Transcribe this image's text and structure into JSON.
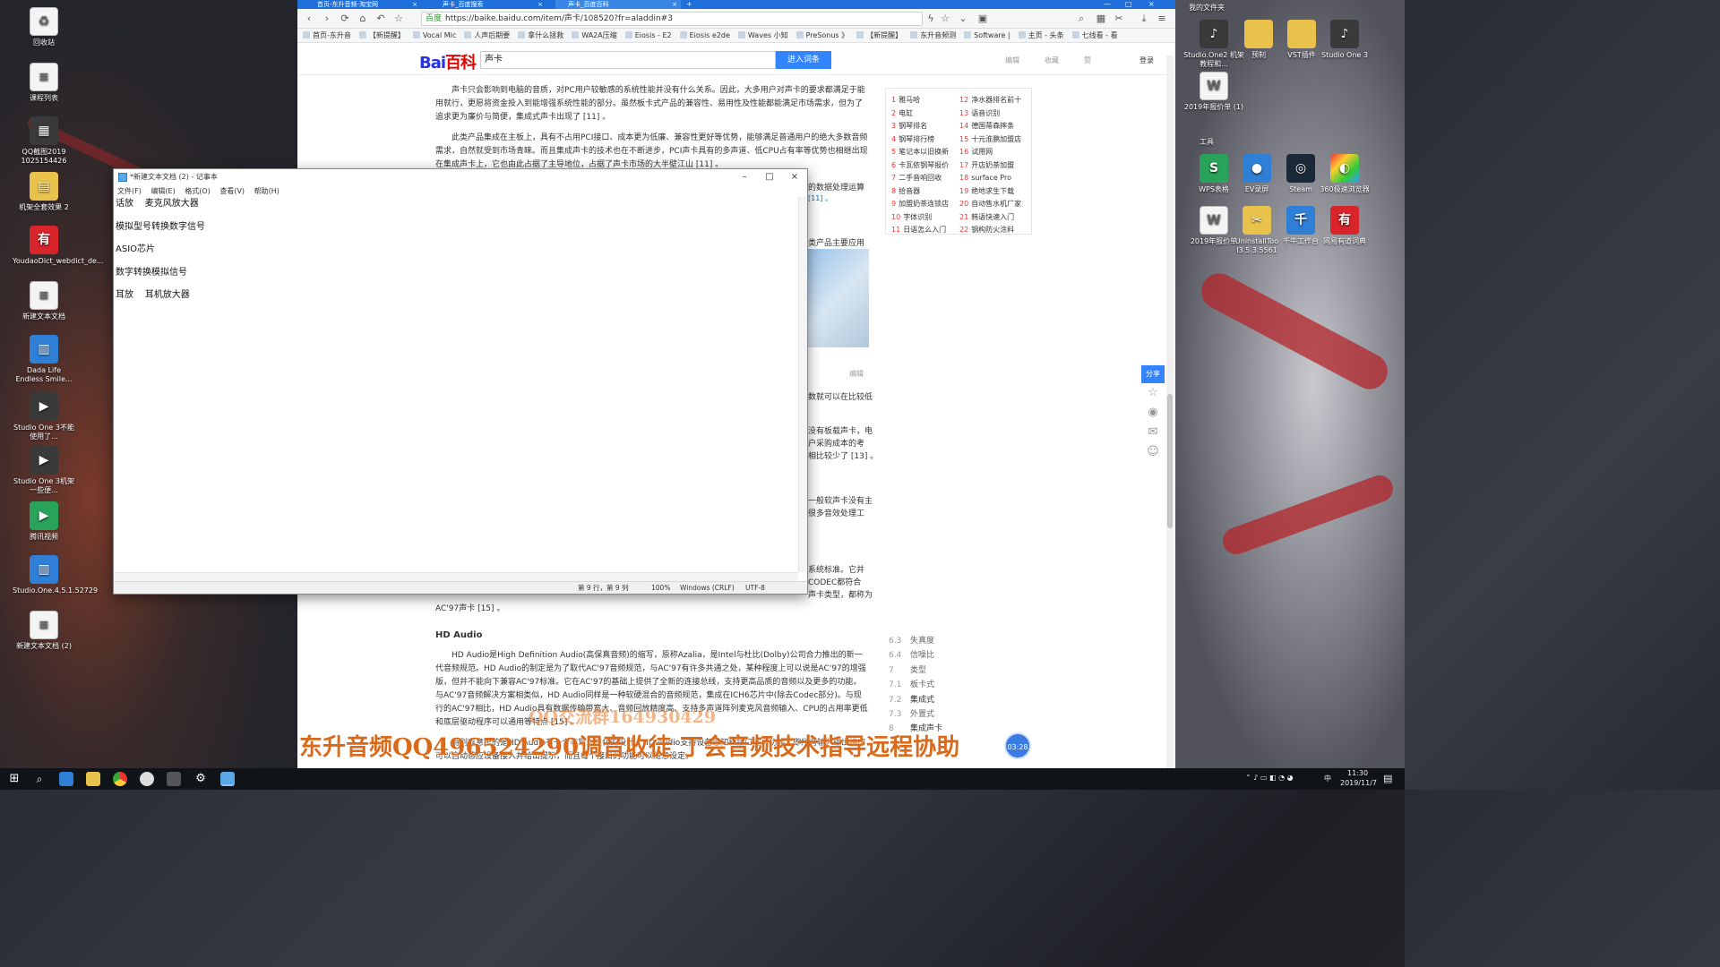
{
  "desktop_left": [
    {
      "label": "回收站",
      "icon": "recycle-bin-icon"
    },
    {
      "label": "课程列表",
      "icon": "text-file-icon"
    },
    {
      "label": "QQ截图2019 1025154426",
      "icon": "image-file-icon"
    },
    {
      "label": "机架全套效果 2",
      "icon": "archive-icon"
    },
    {
      "label": "YoudaoDict_webdict_de...",
      "icon": "youdao-icon"
    },
    {
      "label": "新建文本文档",
      "icon": "text-file-icon"
    },
    {
      "label": "Dada Life Endless Smile...",
      "icon": "zip-icon"
    },
    {
      "label": "Studio One 3不能使用了...",
      "icon": "video-file-icon"
    },
    {
      "label": "Studio One 3机架一些便...",
      "icon": "video-file-icon"
    },
    {
      "label": "腾讯视频",
      "icon": "tencent-video-icon"
    },
    {
      "label": "Studio.One.4.5.1.52729",
      "icon": "zip-icon"
    },
    {
      "label": "新建文本文档 (2)",
      "icon": "text-file-icon"
    }
  ],
  "desktop_right": [
    {
      "label": "我的文件夹",
      "icon": "folder-icon"
    },
    {
      "label": "Studio.One2 机架教程和...",
      "icon": "folder-icon"
    },
    {
      "label": "预制",
      "icon": "folder-icon"
    },
    {
      "label": "VST插件",
      "icon": "folder-icon"
    },
    {
      "label": "Studio One 3",
      "icon": "studio-one-icon"
    },
    {
      "label": "2019年报价单 (1)",
      "icon": "doc-file-icon"
    },
    {
      "label": "工具",
      "icon": "folder-icon"
    },
    {
      "label": "WPS表格",
      "icon": "wps-icon"
    },
    {
      "label": "EV录屏",
      "icon": "ev-recorder-icon"
    },
    {
      "label": "Steam",
      "icon": "steam-icon"
    },
    {
      "label": "360极速浏览器",
      "icon": "browser-360-icon"
    },
    {
      "label": "2019年报价单",
      "icon": "doc-file-icon"
    },
    {
      "label": "UninstallToo l3.5.3.5561",
      "icon": "uninstall-icon"
    },
    {
      "label": "千牛工作台",
      "icon": "qianniu-icon"
    },
    {
      "label": "网易有道词典",
      "icon": "youdao-icon"
    }
  ],
  "browser": {
    "tabs": [
      "首页-东升音频-淘宝网",
      "声卡_百度搜索",
      "声卡_百度百科"
    ],
    "url": "https://baike.baidu.com/item/声卡/108520?fr=aladdin#3",
    "url_badge": "百度",
    "bookmarks": [
      "首页-东升音",
      "【新提醒】",
      "Vocal Mic",
      "人声后期要",
      "拿什么拯救",
      "WA2A压缩",
      "Eiosis - E2",
      "Eiosis e2de",
      "Waves 小知",
      "PreSonus 》",
      "【新提醒】",
      "东升音频测",
      "Software |",
      "主页 - 头条",
      "七线看 - 看"
    ],
    "logo_a": "Bai",
    "logo_b": "百科",
    "search_value": "声卡",
    "enter_button": "进入词条",
    "header_links": [
      "编辑",
      "收藏",
      "赞",
      "登录"
    ],
    "paragraphs": [
      "声卡只会影响到电脑的音质，对PC用户较敏感的系统性能并没有什么关系。因此，大多用户对声卡的要求都满足于能用就行，更愿将资金投入到能增强系统性能的部分。虽然板卡式产品的兼容性、易用性及性能都能满足市场需求，但为了追求更为廉价与简便，集成式声卡出现了 [11] 。",
      "此类产品集成在主板上，具有不占用PCI接口、成本更为低廉、兼容性更好等优势，能够满足普通用户的绝大多数音频需求，自然就受到市场青睐。而且集成声卡的技术也在不断进步，PCI声卡具有的多声道、低CPU占有率等优势也相继出现在集成声卡上，它也由此占据了主导地位，占据了声卡市场的大半壁江山 [11] 。"
    ],
    "fragments": [
      "的数据处理运算",
      "[11] 。",
      "类产品主要应用",
      "数就可以在比较低",
      "没有板载声卡，电",
      "户采购成本的考",
      "相比较少了 [13] 。",
      "一般软声卡没有主",
      "很多音效处理工",
      "系统标准。它并",
      "CODEC都符合",
      "声卡类型，都称为",
      "AC'97声卡 [15] 。"
    ],
    "section_title": "HD Audio",
    "hd_paragraph": "HD Audio是High Definition Audio(高保真音频)的缩写，原称Azalia，是Intel与杜比(Dolby)公司合力推出的新一代音频规范。HD Audio的制定是为了取代AC'97音频规范，与AC'97有许多共通之处，某种程度上可以说是AC'97的增强版，但并不能向下兼容AC'97标准。它在AC'97的基础上提供了全新的连接总线，支持更高品质的音频以及更多的功能。与AC'97音频解决方案相类似，HD Audio同样是一种软硬混合的音频规范，集成在ICH6芯片中(除去Codec部分)。与现行的AC'97相比，HD Audio具有数据传输带宽大、音频回放精度高、支持多声道阵列麦克风音频输入、CPU的占用率更低和底层驱动程序可以通用等特点 [15] 。",
    "hd_paragraph2": "特别有意思的是HD Audio有一个非常人性化的设计，HD Audio支持设备感知和接口定义功能，即所有输入输出接口可以自动感应设备接入并给出提示，而且每个接口的功能可以随意设定。",
    "edit_label": "编辑",
    "ranking": [
      "雅马哈",
      "电缸",
      "钢琴排名",
      "钢琴排行榜",
      "笔记本以旧换新",
      "卡瓦依钢琴报价",
      "二手音响回收",
      "拾音器",
      "加盟奶茶连锁店",
      "字体识别",
      "日语怎么入门",
      "净水器排名前十",
      "语音识别",
      "德国蒂森摔条",
      "十元淮鹏加盟店",
      "试用网",
      "开店奶茶加盟",
      "surface Pro",
      "绝地求生下载",
      "自动售水机厂家",
      "韩语快速入门",
      "钢构防火涂料"
    ],
    "catalog": [
      {
        "num": "6.3",
        "label": "失真度"
      },
      {
        "num": "6.4",
        "label": "信噪比"
      },
      {
        "num": "7",
        "label": "类型"
      },
      {
        "num": "7.1",
        "label": "板卡式"
      },
      {
        "num": "7.2",
        "label": "集成式"
      },
      {
        "num": "7.3",
        "label": "外置式"
      },
      {
        "num": "8",
        "label": "集成声卡"
      }
    ],
    "share_label": "分享",
    "timer": "03:28"
  },
  "notepad": {
    "title": "*新建文本文档 (2) - 记事本",
    "menu": [
      "文件(F)",
      "编辑(E)",
      "格式(O)",
      "查看(V)",
      "帮助(H)"
    ],
    "content": "话放    麦克风放大器\n\n模拟型号转换数字信号\n\nASIO芯片\n\n数字转换模拟信号\n\n耳放    耳机放大器",
    "status_pos": "第 9 行，第 9 列",
    "status_zoom": "100%",
    "status_eol": "Windows (CRLF)",
    "status_enc": "UTF-8"
  },
  "watermark_qq": "QQ交流群164930429",
  "watermark_main": "东升音频QQ496524290调音收徒 丁会音频技术指导远程协助",
  "taskbar": {
    "time": "11:30",
    "date": "2019/11/7",
    "ime": "中"
  }
}
